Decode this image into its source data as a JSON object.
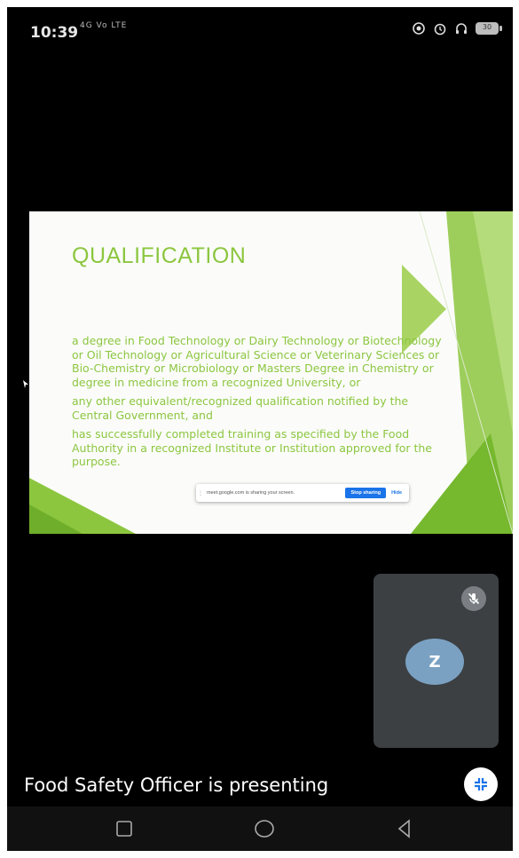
{
  "status_bar": {
    "time": "10:39",
    "signal_text": "4G Vo LTE",
    "icons": [
      "hotspot-icon",
      "alarm-icon",
      "headphones-icon",
      "battery-icon"
    ],
    "battery": "30"
  },
  "slide": {
    "title": "QUALIFICATION",
    "paragraphs": [
      "a degree in Food Technology or Dairy Technology or Biotechnology or Oil Technology or Agricultural Science or Veterinary Sciences or Bio-Chemistry or Microbiology or Masters Degree in Chemistry or degree in medicine from a recognized University, or",
      "any other equivalent/recognized qualification notified by the Central Government, and",
      "has successfully completed training as specified by the Food Authority in a recognized Institute or Institution approved for the purpose."
    ],
    "accent_color": "#8cc63f"
  },
  "share_bar": {
    "message": "meet.google.com is sharing your screen.",
    "stop_label": "Stop sharing",
    "hide_label": "Hide"
  },
  "self_tile": {
    "initial": "Z",
    "mic_icon": "mic-off-icon"
  },
  "footer": {
    "presenting_text": "Food Safety Officer is presenting",
    "collapse_icon": "exit-fullscreen-icon"
  },
  "nav_bar": {
    "buttons": [
      "recents-button",
      "home-button",
      "back-button"
    ]
  }
}
